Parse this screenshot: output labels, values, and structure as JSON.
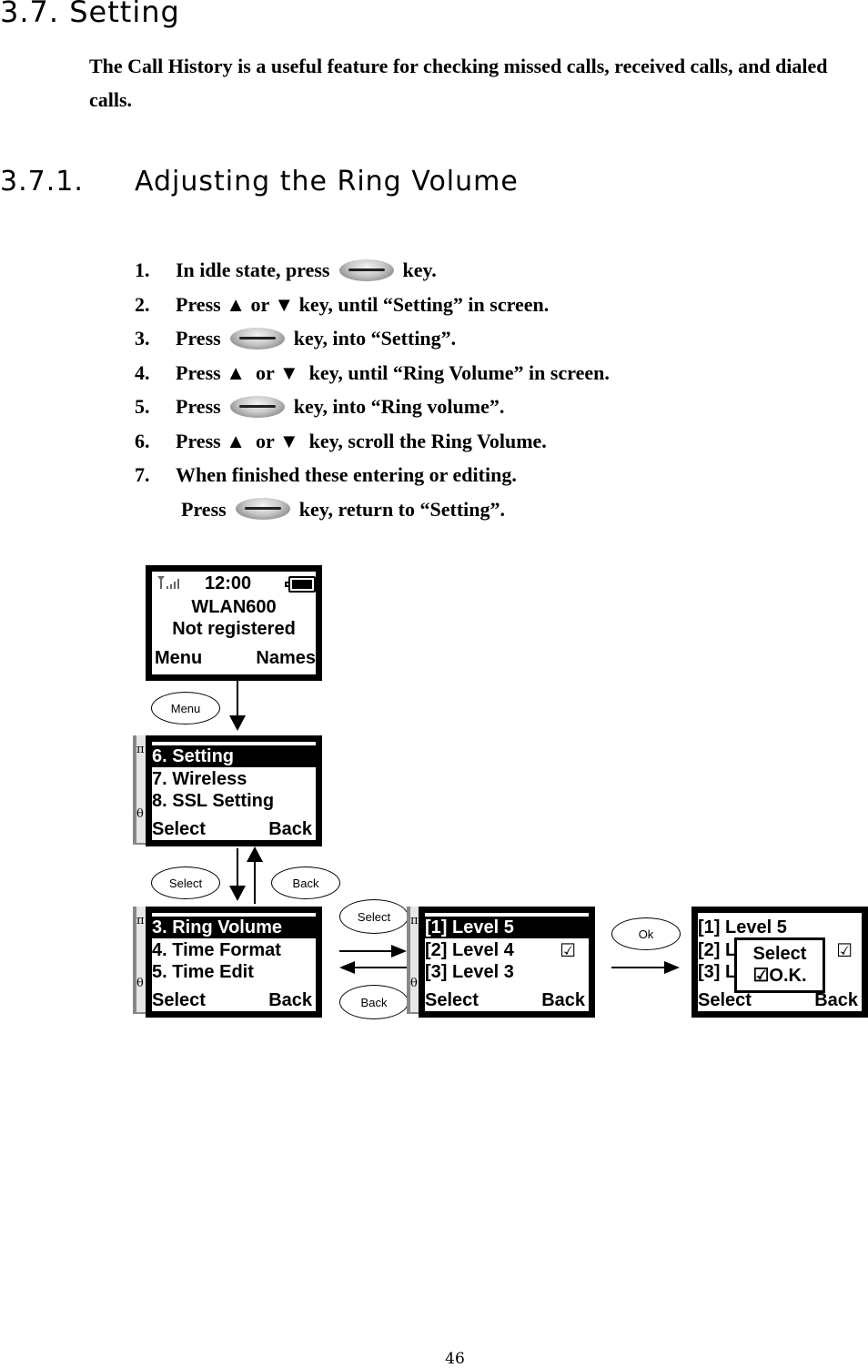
{
  "section": {
    "heading": "3.7.  Setting",
    "intro": "The Call History is a useful feature for checking missed calls, received calls, and dialed calls."
  },
  "subsection": {
    "number": "3.7.1.",
    "title": "Adjusting the Ring Volume"
  },
  "steps": [
    {
      "num": "1.",
      "before": "In idle state, press",
      "key": "center-key-icon",
      "after": "key."
    },
    {
      "num": "2.",
      "text": "Press ▲ or ▼ key, until “Setting” in screen."
    },
    {
      "num": "3.",
      "before": "Press",
      "key": "center-key-icon",
      "after": "key, into “Setting”."
    },
    {
      "num": "4.",
      "text": "Press ▲  or ▼  key, until “Ring Volume” in screen."
    },
    {
      "num": "5.",
      "before": "Press",
      "key": "center-key-icon",
      "after": "key, into “Ring volume”."
    },
    {
      "num": "6.",
      "text": "Press ▲  or ▼  key, scroll the Ring Volume."
    },
    {
      "num": "7.",
      "text": "When finished these entering or editing."
    },
    {
      "num": "",
      "before": "Press",
      "key": "center-key-icon",
      "after": "key, return to “Setting”."
    }
  ],
  "diagram": {
    "idle_screen": {
      "time": "12:00",
      "name": "WLAN600",
      "status": "Not registered",
      "soft_left": "Menu",
      "soft_right": "Names"
    },
    "menu_screen": {
      "items": [
        "6. Setting",
        "7. Wireless",
        "8. SSL Setting"
      ],
      "highlighted": 0,
      "soft_left": "Select",
      "soft_right": "Back",
      "scroll_top": "π",
      "scroll_bottom": "θ"
    },
    "setting_screen": {
      "items": [
        "3. Ring Volume",
        "4. Time Format",
        "5. Time Edit"
      ],
      "highlighted": 0,
      "soft_left": "Select",
      "soft_right": "Back",
      "scroll_top": "π",
      "scroll_bottom": "θ"
    },
    "volume_screen": {
      "items": [
        "[1] Level 5",
        "[2] Level 4",
        "[3] Level 3"
      ],
      "highlighted": 0,
      "checked": 1,
      "check_glyph": "☑",
      "soft_left": "Select",
      "soft_right": "Back",
      "scroll_top": "π",
      "scroll_bottom": "θ"
    },
    "confirm_screen": {
      "items": [
        "[1] Level 5",
        "[2] Level 4",
        "[3] Level 3"
      ],
      "check_glyph": "☑",
      "soft_left": "Select",
      "soft_right": "Back",
      "popup_line1": "Select",
      "popup_line2": "☑O.K."
    },
    "labels": {
      "menu": "Menu",
      "select_down": "Select",
      "back_up": "Back",
      "select_right": "Select",
      "back_left": "Back",
      "ok": "Ok"
    }
  },
  "page_number": "46"
}
